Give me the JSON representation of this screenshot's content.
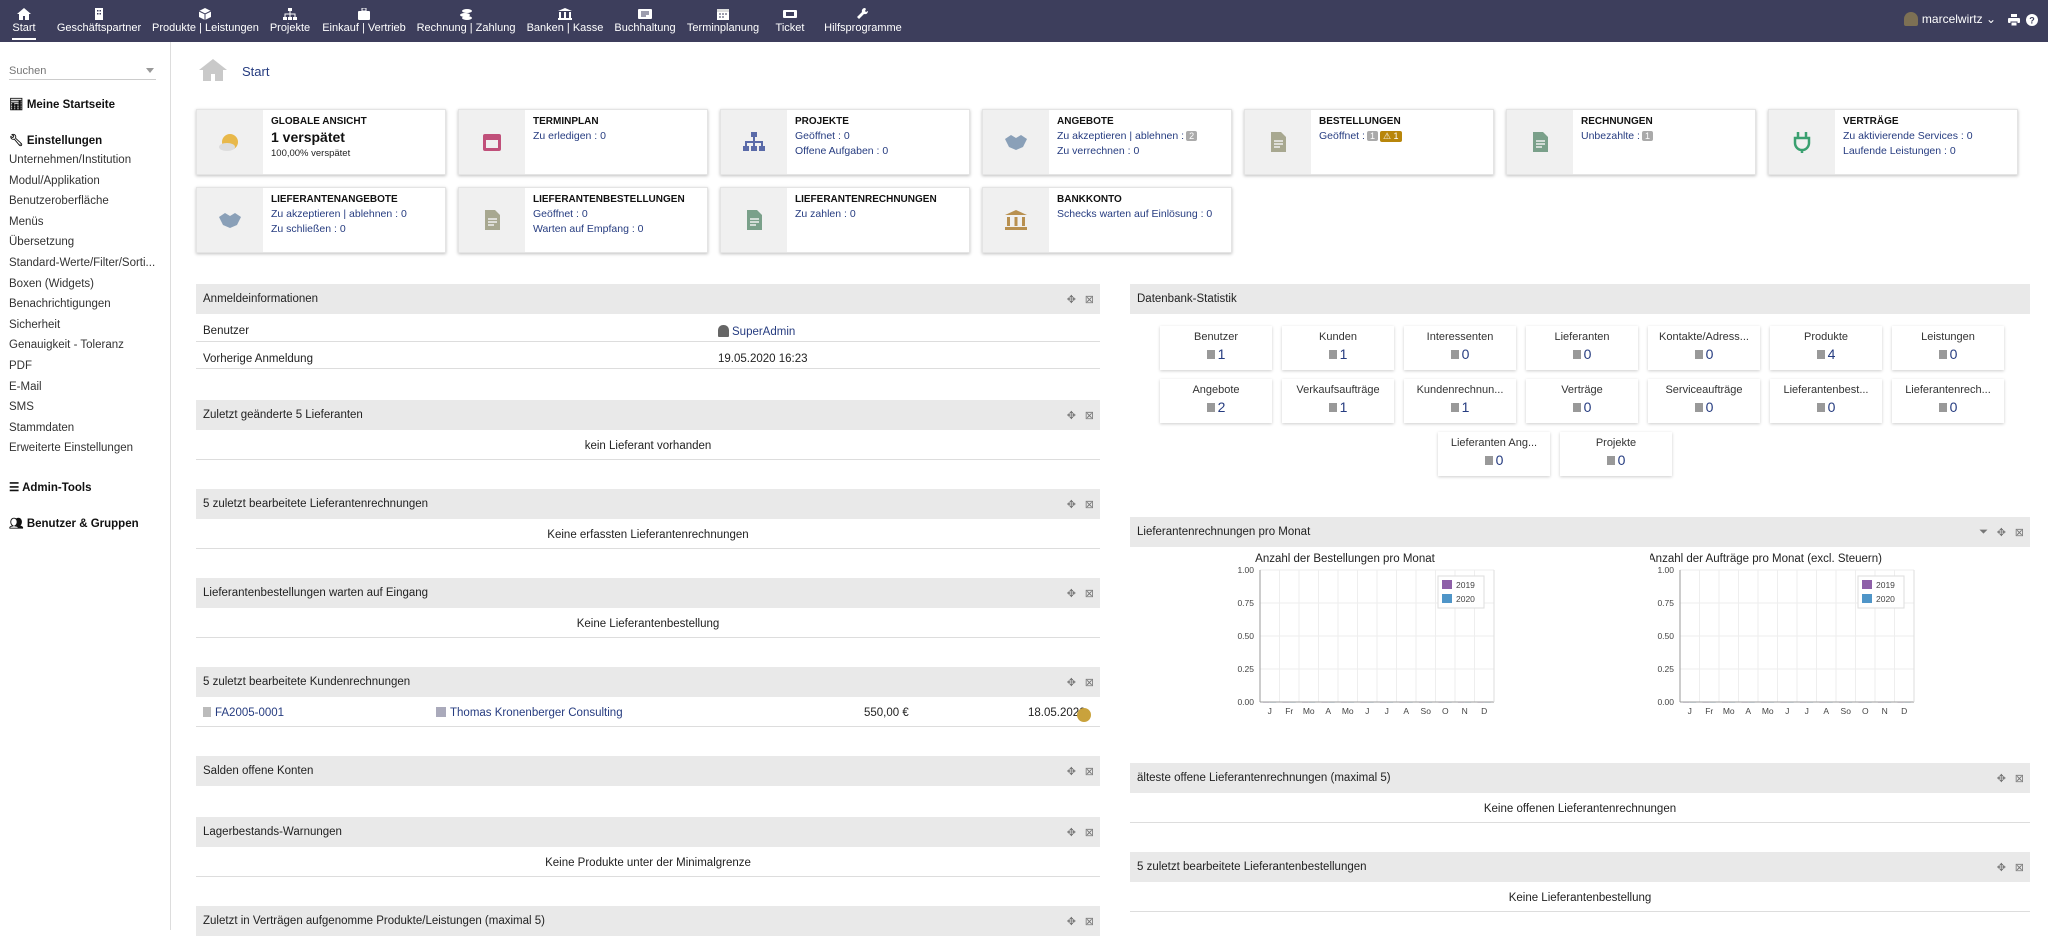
{
  "menu": [
    {
      "label": "Start",
      "icon": "home-icon"
    },
    {
      "label": "Geschäftspartner",
      "icon": "building-icon"
    },
    {
      "label": "Produkte | Leistungen",
      "icon": "cube-icon"
    },
    {
      "label": "Projekte",
      "icon": "sitemap-icon"
    },
    {
      "label": "Einkauf | Vertrieb",
      "icon": "suitcase-icon"
    },
    {
      "label": "Rechnung | Zahlung",
      "icon": "coins-icon"
    },
    {
      "label": "Banken | Kasse",
      "icon": "bank-icon"
    },
    {
      "label": "Buchhaltung",
      "icon": "ledger-icon"
    },
    {
      "label": "Terminplanung",
      "icon": "calendar-icon"
    },
    {
      "label": "Ticket",
      "icon": "ticket-icon"
    },
    {
      "label": "Hilfsprogramme",
      "icon": "wrench-icon"
    }
  ],
  "user": {
    "name": "marcelwirtz"
  },
  "sidebar": {
    "search_placeholder": "Suchen",
    "home": "Meine Startseite",
    "settings": "Einstellungen",
    "items": [
      "Unternehmen/Institution",
      "Modul/Applikation",
      "Benutzeroberfläche",
      "Menüs",
      "Übersetzung",
      "Standard-Werte/Filter/Sorti...",
      "Boxen (Widgets)",
      "Benachrichtigungen",
      "Sicherheit",
      "Genauigkeit - Toleranz",
      "PDF",
      "E-Mail",
      "SMS",
      "Stammdaten",
      "Erweiterte Einstellungen"
    ],
    "admin": "Admin-Tools",
    "users": "Benutzer & Gruppen"
  },
  "breadcrumb": "Start",
  "cards": [
    {
      "title": "Globale Ansicht",
      "line1": "1 verspätet",
      "line2": "100,00% verspätet",
      "icon": "weather-icon"
    },
    {
      "title": "Terminplan",
      "line1": "Zu erledigen : 0",
      "line2": "",
      "icon": "calendar-icon"
    },
    {
      "title": "Projekte",
      "line1": "Geöffnet : 0",
      "line2": "Offene Aufgaben : 0",
      "icon": "sitemap-icon"
    },
    {
      "title": "Angebote",
      "line1": "Zu akzeptieren | ablehnen :",
      "line1_badge": "2",
      "line2": "Zu verrechnen : 0",
      "icon": "handshake-icon"
    },
    {
      "title": "Bestellungen",
      "line1": "Geöffnet :",
      "line1_badge": "1",
      "line1_warn": "1",
      "line2": "",
      "icon": "document-icon"
    },
    {
      "title": "Rechnungen",
      "line1": "Unbezahlte :",
      "line1_badge": "1",
      "line2": "",
      "icon": "invoice-icon"
    },
    {
      "title": "Verträge",
      "line1": "Zu aktivierende Services : 0",
      "line2": "Laufende Leistungen : 0",
      "icon": "plug-icon"
    },
    {
      "title": "Lieferantenangebote",
      "line1": "Zu akzeptieren | ablehnen : 0",
      "line2": "Zu schließen : 0",
      "icon": "handshake-icon"
    },
    {
      "title": "Lieferantenbestellungen",
      "line1": "Geöffnet : 0",
      "line2": "Warten auf Empfang : 0",
      "icon": "document-icon"
    },
    {
      "title": "Lieferantenrechnungen",
      "line1": "Zu zahlen : 0",
      "line2": "",
      "icon": "invoice-icon"
    },
    {
      "title": "Bankkonto",
      "line1": "Schecks warten auf Einlösung : 0",
      "line2": "",
      "icon": "bank-icon"
    }
  ],
  "login": {
    "title": "Anmeldeinformationen",
    "user_label": "Benutzer",
    "user_value": "SuperAdmin",
    "last_label": "Vorherige Anmeldung",
    "last_value": "19.05.2020 16:23"
  },
  "boxes": {
    "suppliers": {
      "title": "Zuletzt geänderte 5 Lieferanten",
      "msg": "kein Lieferant vorhanden"
    },
    "supplier_invoices": {
      "title": "5 zuletzt bearbeitete Lieferantenrechnungen",
      "msg": "Keine erfassten Lieferantenrechnungen"
    },
    "supplier_orders_wait": {
      "title": "Lieferantenbestellungen warten auf Eingang",
      "msg": "Keine Lieferantenbestellung"
    },
    "customer_invoices": {
      "title": "5 zuletzt bearbeitete Kundenrechnungen",
      "ref": "FA2005-0001",
      "company": "Thomas Kronenberger Consulting",
      "amount": "550,00 €",
      "date": "18.05.2020"
    },
    "balances": {
      "title": "Salden offene Konten"
    },
    "stock": {
      "title": "Lagerbestands-Warnungen",
      "msg": "Keine Produkte unter der Minimalgrenze"
    },
    "contracts": {
      "title": "Zuletzt in Verträgen aufgenomme Produkte/Leistungen (maximal 5)"
    },
    "oldest": {
      "title": "älteste offene Lieferantenrechnungen (maximal 5)",
      "msg": "Keine offenen Lieferantenrechnungen"
    },
    "last_orders": {
      "title": "5 zuletzt bearbeitete Lieferantenbestellungen",
      "msg": "Keine Lieferantenbestellung"
    },
    "monthly": {
      "title": "Lieferantenrechnungen pro Monat"
    }
  },
  "stats": {
    "title": "Datenbank-Statistik",
    "items": [
      {
        "label": "Benutzer",
        "value": "1"
      },
      {
        "label": "Kunden",
        "value": "1"
      },
      {
        "label": "Interessenten",
        "value": "0"
      },
      {
        "label": "Lieferanten",
        "value": "0"
      },
      {
        "label": "Kontakte/Adress...",
        "value": "0"
      },
      {
        "label": "Produkte",
        "value": "4"
      },
      {
        "label": "Leistungen",
        "value": "0"
      },
      {
        "label": "Angebote",
        "value": "2"
      },
      {
        "label": "Verkaufsaufträge",
        "value": "1"
      },
      {
        "label": "Kundenrechnun...",
        "value": "1"
      },
      {
        "label": "Verträge",
        "value": "0"
      },
      {
        "label": "Serviceaufträge",
        "value": "0"
      },
      {
        "label": "Lieferantenbest...",
        "value": "0"
      },
      {
        "label": "Lieferantenrech...",
        "value": "0"
      },
      {
        "label": "Lieferanten Ang...",
        "value": "0"
      },
      {
        "label": "Projekte",
        "value": "0"
      }
    ]
  },
  "chart_data": [
    {
      "type": "bar",
      "title": "Anzahl der Bestellungen pro Monat",
      "categories": [
        "J",
        "Fr",
        "Mo",
        "A",
        "Mo",
        "J",
        "J",
        "A",
        "So",
        "O",
        "N",
        "D"
      ],
      "series": [
        {
          "name": "2019",
          "values": [
            0,
            0,
            0,
            0,
            0,
            0,
            0,
            0,
            0,
            0,
            0,
            0
          ],
          "color": "#8e5fa8"
        },
        {
          "name": "2020",
          "values": [
            0,
            0,
            0,
            0,
            0,
            0,
            0,
            0,
            0,
            0,
            0,
            0
          ],
          "color": "#4f95c8"
        }
      ],
      "ylim": [
        0,
        1
      ],
      "yticks": [
        "0.00",
        "0.25",
        "0.50",
        "0.75",
        "1.00"
      ],
      "legend": "top-right",
      "grid": true
    },
    {
      "type": "bar",
      "title": "Anzahl der Aufträge pro Monat (excl. Steuern)",
      "categories": [
        "J",
        "Fr",
        "Mo",
        "A",
        "Mo",
        "J",
        "J",
        "A",
        "So",
        "O",
        "N",
        "D"
      ],
      "series": [
        {
          "name": "2019",
          "values": [
            0,
            0,
            0,
            0,
            0,
            0,
            0,
            0,
            0,
            0,
            0,
            0
          ],
          "color": "#8e5fa8"
        },
        {
          "name": "2020",
          "values": [
            0,
            0,
            0,
            0,
            0,
            0,
            0,
            0,
            0,
            0,
            0,
            0
          ],
          "color": "#4f95c8"
        }
      ],
      "ylim": [
        0,
        1
      ],
      "yticks": [
        "0.00",
        "0.25",
        "0.50",
        "0.75",
        "1.00"
      ],
      "legend": "top-right",
      "grid": true
    }
  ]
}
